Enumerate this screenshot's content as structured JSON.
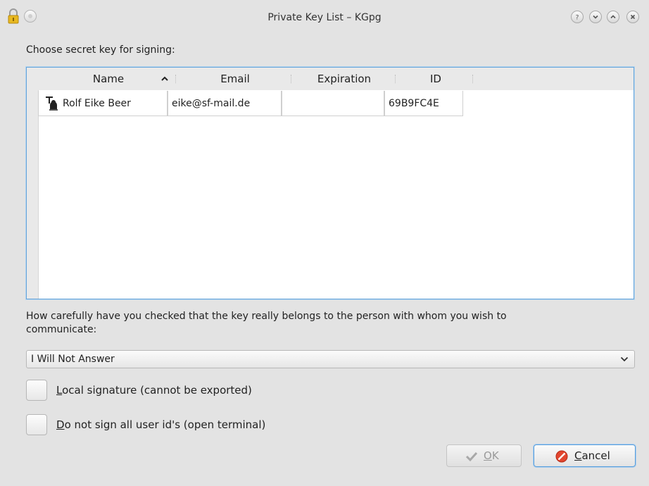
{
  "window": {
    "title": "Private Key List – KGpg",
    "icons": [
      "lock-icon",
      "window-menu-icon",
      "help-icon",
      "minimize-icon",
      "maximize-icon",
      "close-icon"
    ]
  },
  "prompt_label": "Choose secret key for signing:",
  "key_list": {
    "columns": [
      "Name",
      "Email",
      "Expiration",
      "ID"
    ],
    "sorted_by": "Name",
    "rows": [
      {
        "name": "Rolf Eike Beer",
        "email": "eike@sf-mail.de",
        "expiration": "",
        "id": "69B9FC4E",
        "icon": "key-pair-icon"
      }
    ]
  },
  "trust_question_line1": "How carefully have you checked that the key really belongs to the person with whom you wish to",
  "trust_question_line2": "communicate:",
  "trust_select": {
    "value": "I Will Not Answer"
  },
  "options": {
    "local_signature": {
      "mnemonic": "L",
      "rest": "ocal signature (cannot be exported)",
      "checked": false
    },
    "no_sign_all": {
      "mnemonic": "D",
      "rest": "o not sign all user id's (open terminal)",
      "checked": false
    }
  },
  "buttons": {
    "ok": {
      "mnemonic": "O",
      "rest": "K",
      "enabled": false
    },
    "cancel": {
      "mnemonic": "C",
      "rest": "ancel"
    }
  },
  "colors": {
    "focus": "#5a9fdc",
    "cancel_icon": "#e2462f",
    "lock": "#e8b820"
  }
}
